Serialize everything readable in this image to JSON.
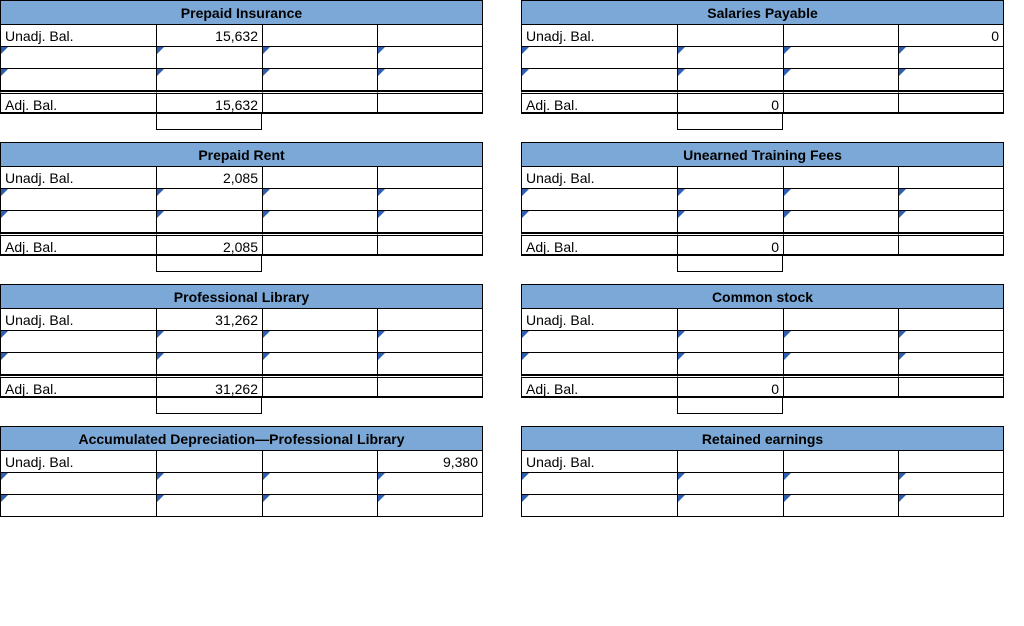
{
  "labels": {
    "unadj": "Unadj. Bal.",
    "adj": "Adj. Bal."
  },
  "left": [
    {
      "title": "Prepaid Insurance",
      "unadj_debit": "15,632",
      "unadj_credit": "",
      "adj_debit": "15,632",
      "adj_credit": ""
    },
    {
      "title": "Prepaid Rent",
      "unadj_debit": "2,085",
      "unadj_credit": "",
      "adj_debit": "2,085",
      "adj_credit": ""
    },
    {
      "title": "Professional Library",
      "unadj_debit": "31,262",
      "unadj_credit": "",
      "adj_debit": "31,262",
      "adj_credit": ""
    },
    {
      "title": "Accumulated Depreciation—Professional Library",
      "unadj_debit": "",
      "unadj_credit": "9,380",
      "adj_debit": "",
      "adj_credit": "",
      "partial": true
    }
  ],
  "right": [
    {
      "title": "Salaries Payable",
      "unadj_debit": "",
      "unadj_credit": "0",
      "adj_debit": "0",
      "adj_credit": ""
    },
    {
      "title": "Unearned Training Fees",
      "unadj_debit": "",
      "unadj_credit": "",
      "adj_debit": "0",
      "adj_credit": ""
    },
    {
      "title": "Common stock",
      "unadj_debit": "",
      "unadj_credit": "",
      "adj_debit": "0",
      "adj_credit": ""
    },
    {
      "title": "Retained earnings",
      "unadj_debit": "",
      "unadj_credit": "",
      "adj_debit": "",
      "adj_credit": "",
      "partial": true
    }
  ]
}
